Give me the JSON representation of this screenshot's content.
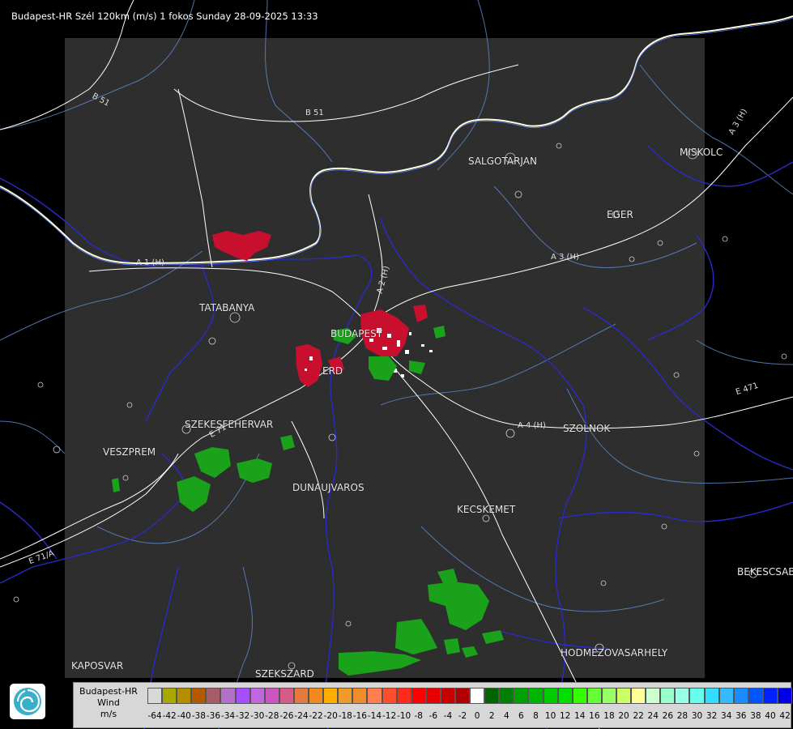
{
  "title": "Budapest-HR Szél 120km (m/s) 1 fokos Sunday 28-09-2025 13:33",
  "cities": [
    {
      "name": "SALGOTARJAN"
    },
    {
      "name": "MISKOLC"
    },
    {
      "name": "EGER"
    },
    {
      "name": "TATABANYA"
    },
    {
      "name": "BUDAPEST"
    },
    {
      "name": "ERD"
    },
    {
      "name": "SZEKESFEHERVAR"
    },
    {
      "name": "VESZPREM"
    },
    {
      "name": "DUNAUJVAROS"
    },
    {
      "name": "KECSKEMET"
    },
    {
      "name": "SZOLNOK"
    },
    {
      "name": "BEKESCSABA"
    },
    {
      "name": "HODMEZOVASARHELY"
    },
    {
      "name": "KAPOSVAR"
    },
    {
      "name": "SZEKSZARD"
    }
  ],
  "roads": [
    "B 51",
    "B 51",
    "A 1 (H)",
    "A 2 (H)",
    "A 3 (H)",
    "A 3 (H)",
    "E 71",
    "E 71/A",
    "A 4 (H)",
    "E 471"
  ],
  "legend": {
    "line1": "Budapest-HR",
    "line2": "Wind",
    "line3": "m/s",
    "ticks": [
      "-64",
      "-42",
      "-40",
      "-38",
      "-36",
      "-34",
      "-32",
      "-30",
      "-28",
      "-26",
      "-24",
      "-22",
      "-20",
      "-18",
      "-16",
      "-14",
      "-12",
      "-10",
      "-8",
      "-6",
      "-4",
      "-2",
      "0",
      "2",
      "4",
      "6",
      "8",
      "10",
      "12",
      "14",
      "16",
      "18",
      "20",
      "22",
      "24",
      "26",
      "28",
      "30",
      "32",
      "34",
      "36",
      "38",
      "40",
      "42"
    ],
    "colors": [
      "#d9d9d9",
      "#a8a800",
      "#b38f00",
      "#b35a00",
      "#a85c6a",
      "#b46fc8",
      "#a64dff",
      "#c266e0",
      "#cc55c2",
      "#d65a8a",
      "#e6793d",
      "#f08a1f",
      "#ffae00",
      "#f09a2a",
      "#f08c2a",
      "#ff7f50",
      "#ff4d2e",
      "#ff2a1a",
      "#ff0000",
      "#e60000",
      "#c80000",
      "#b00000",
      "#ffffff",
      "#006400",
      "#008000",
      "#00a000",
      "#00b400",
      "#00cc00",
      "#00e000",
      "#33ff00",
      "#66ff33",
      "#99ff66",
      "#ccff66",
      "#ffff99",
      "#ccffcc",
      "#99ffcc",
      "#99ffe6",
      "#66ffee",
      "#33ddff",
      "#33bbff",
      "#1a8cff",
      "#0055ff",
      "#0022ff",
      "#0000e6"
    ]
  },
  "colors": {
    "background": "#000000",
    "radar_area": "#2e2e2e",
    "rivers": "#2a2ac8",
    "roads": "#ffffff",
    "borders": "#ffffe0",
    "contours": "#5b86c8"
  },
  "icons": [
    "met-service-logo-icon"
  ]
}
